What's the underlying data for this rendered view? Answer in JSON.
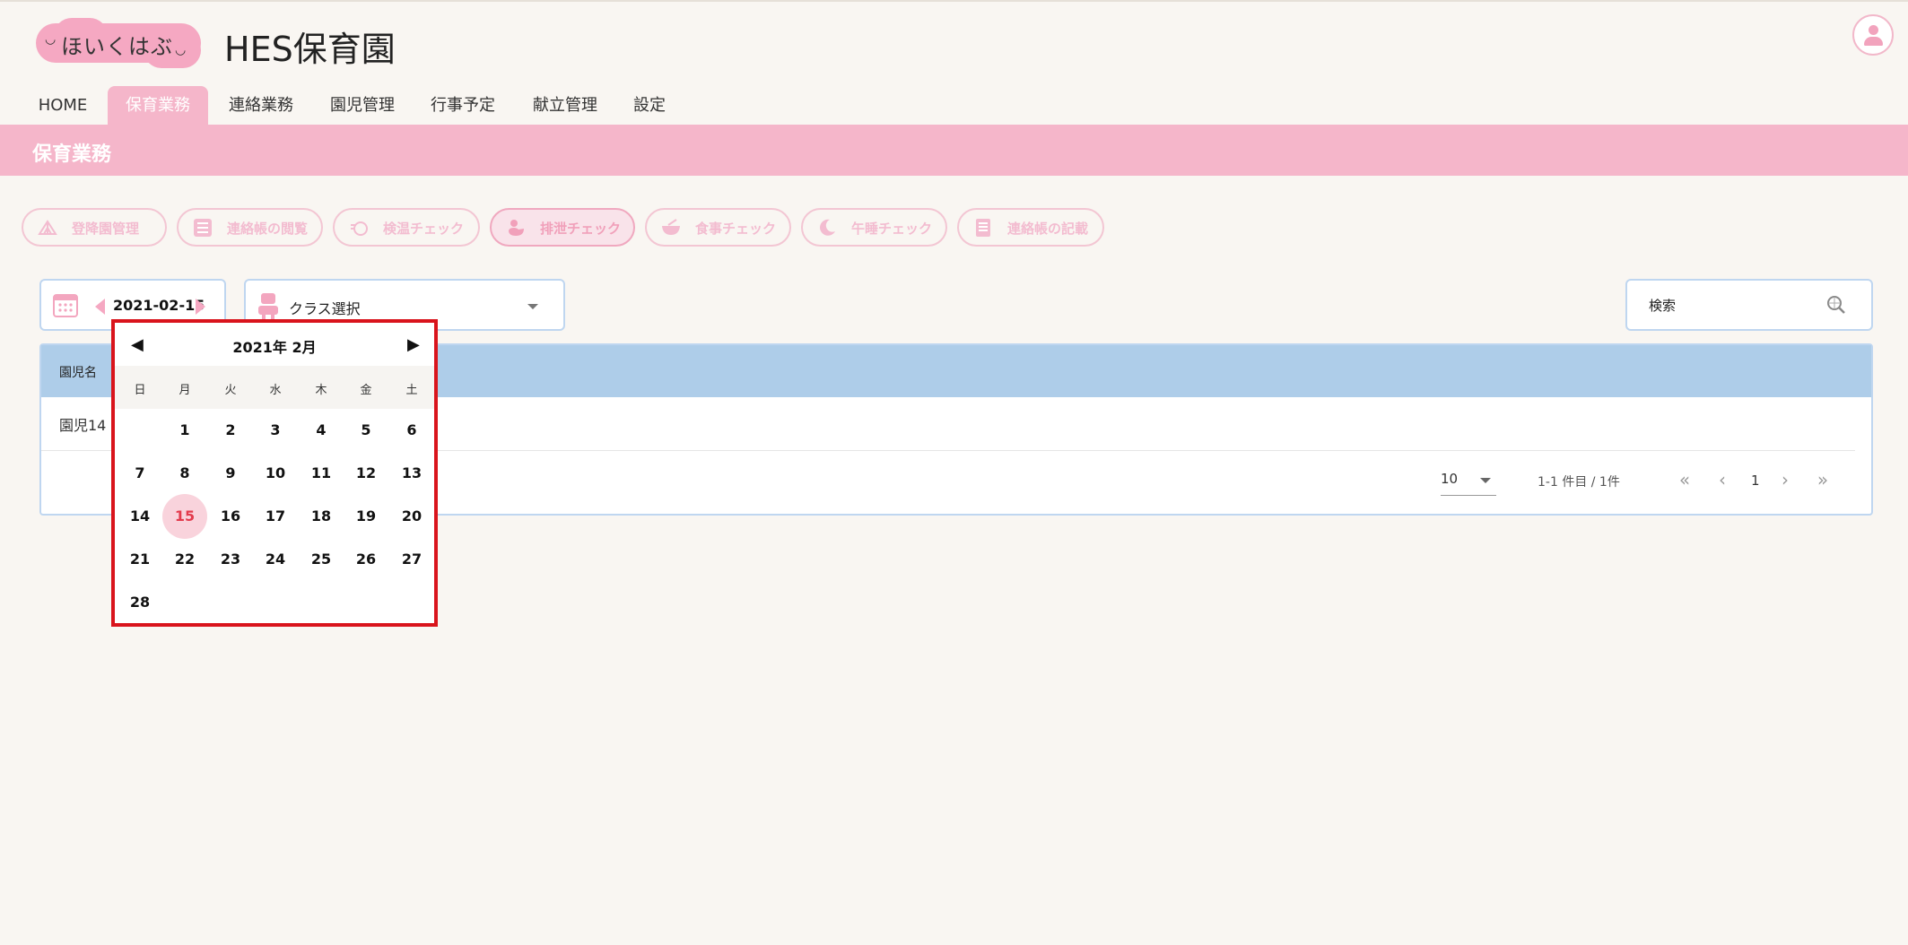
{
  "header": {
    "logo_text": "ほいくはぶ",
    "site_title": "HES保育園"
  },
  "nav": {
    "items": [
      {
        "label": "HOME"
      },
      {
        "label": "保育業務"
      },
      {
        "label": "連絡業務"
      },
      {
        "label": "園児管理"
      },
      {
        "label": "行事予定"
      },
      {
        "label": "献立管理"
      },
      {
        "label": "設定"
      }
    ],
    "active": "保育業務"
  },
  "section": {
    "title": "保育業務"
  },
  "functions": [
    {
      "label": "登降園管理",
      "icon": "tent-icon"
    },
    {
      "label": "連絡帳の閲覧",
      "icon": "list-icon"
    },
    {
      "label": "検温チェック",
      "icon": "thermometer-icon"
    },
    {
      "label": "排泄チェック",
      "icon": "duck-icon"
    },
    {
      "label": "食事チェック",
      "icon": "bowl-icon"
    },
    {
      "label": "午睡チェック",
      "icon": "moon-icon"
    },
    {
      "label": "連絡帳の記載",
      "icon": "notebook-icon"
    }
  ],
  "filters": {
    "date": "2021-02-15",
    "class_placeholder": "クラス選択",
    "search_placeholder": "検索"
  },
  "table": {
    "headers": [
      "園児名"
    ],
    "rows": [
      [
        "園児14"
      ]
    ]
  },
  "pagination": {
    "page_size": "10",
    "range_text": "1-1 件目 / 1件",
    "current_page": "1"
  },
  "calendar": {
    "title": "2021年 2月",
    "weekdays": [
      "日",
      "月",
      "火",
      "水",
      "木",
      "金",
      "土"
    ],
    "selected_day": "15",
    "weeks": [
      [
        "",
        "1",
        "2",
        "3",
        "4",
        "5",
        "6"
      ],
      [
        "7",
        "8",
        "9",
        "10",
        "11",
        "12",
        "13"
      ],
      [
        "14",
        "15",
        "16",
        "17",
        "18",
        "19",
        "20"
      ],
      [
        "21",
        "22",
        "23",
        "24",
        "25",
        "26",
        "27"
      ],
      [
        "28",
        "",
        "",
        "",
        "",
        "",
        ""
      ]
    ]
  },
  "colors": {
    "accent_pink": "#f5b6ca",
    "table_header": "#aecde9",
    "highlight_red": "#d9141c"
  }
}
